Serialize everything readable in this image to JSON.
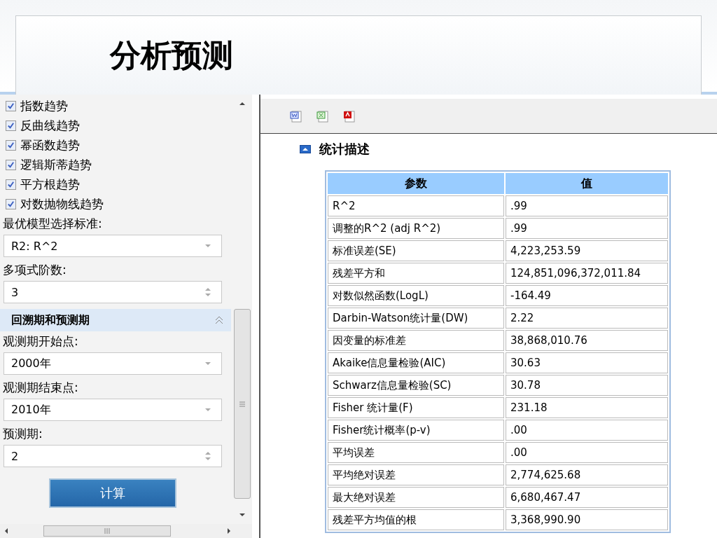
{
  "slide": {
    "title": "分析预测"
  },
  "left_panel": {
    "trend_options": [
      {
        "label": "指数趋势",
        "checked": true
      },
      {
        "label": "反曲线趋势",
        "checked": true
      },
      {
        "label": "幂函数趋势",
        "checked": true
      },
      {
        "label": "逻辑斯蒂趋势",
        "checked": true
      },
      {
        "label": "平方根趋势",
        "checked": true
      },
      {
        "label": "对数抛物线趋势",
        "checked": true
      }
    ],
    "controls": [
      {
        "kind": "label",
        "text": "最优模型选择标准:"
      },
      {
        "kind": "select",
        "value": "R2: R^2"
      },
      {
        "kind": "label",
        "text": "多项式阶数:"
      },
      {
        "kind": "spinner",
        "value": "3"
      },
      {
        "kind": "section",
        "text": "回溯期和预测期",
        "expanded": true
      },
      {
        "kind": "label",
        "text": "观测期开始点:"
      },
      {
        "kind": "select",
        "value": "2000年"
      },
      {
        "kind": "label",
        "text": "观测期结束点:"
      },
      {
        "kind": "select",
        "value": "2010年"
      },
      {
        "kind": "label",
        "text": "预测期:"
      },
      {
        "kind": "spinner",
        "value": "2"
      },
      {
        "kind": "button",
        "text": "计算"
      }
    ]
  },
  "report": {
    "section_title": "统计描述",
    "table": {
      "columns": [
        "参数",
        "值"
      ],
      "rows": [
        [
          "R^2",
          ".99"
        ],
        [
          "调整的R^2 (adj R^2)",
          ".99"
        ],
        [
          "标准误差(SE)",
          "4,223,253.59"
        ],
        [
          "残差平方和",
          "124,851,096,372,011.84"
        ],
        [
          "对数似然函数(LogL)",
          "-164.49"
        ],
        [
          "Darbin-Watson统计量(DW)",
          "2.22"
        ],
        [
          "因变量的标准差",
          "38,868,010.76"
        ],
        [
          "Akaike信息量检验(AIC)",
          "30.63"
        ],
        [
          "Schwarz信息量检验(SC)",
          "30.78"
        ],
        [
          "Fisher 统计量(F)",
          "231.18"
        ],
        [
          "Fisher统计概率(p-v)",
          ".00"
        ],
        [
          "平均误差",
          ".00"
        ],
        [
          "平均绝对误差",
          "2,774,625.68"
        ],
        [
          "最大绝对误差",
          "6,680,467.47"
        ],
        [
          "残差平方均值的根",
          "3,368,990.90"
        ]
      ]
    }
  }
}
